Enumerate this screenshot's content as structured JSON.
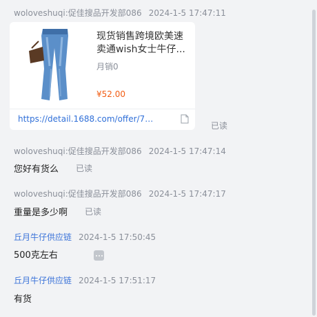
{
  "messages": [
    {
      "sender": "woloveshuqi:促佳搜品开发部086",
      "time": "2024-1-5 17:47:11",
      "card": {
        "title": "现货销售跨境欧美速卖通wish女士牛仔...",
        "sales": "月销0",
        "price": "¥52.00",
        "link": "https://detail.1688.com/offer/75..."
      },
      "status": "已读"
    },
    {
      "sender": "woloveshuqi:促佳搜品开发部086",
      "time": "2024-1-5 17:47:14",
      "text": "您好有货么",
      "status": "已读"
    },
    {
      "sender": "woloveshuqi:促佳搜品开发部086",
      "time": "2024-1-5 17:47:17",
      "text": "重量是多少啊",
      "status": "已读"
    },
    {
      "sender": "丘月牛仔供应链",
      "time": "2024-1-5 17:50:45",
      "text": "500克左右"
    },
    {
      "sender": "丘月牛仔供应链",
      "time": "2024-1-5 17:51:17",
      "text": "有货"
    }
  ],
  "icons": {
    "link": "document-icon",
    "more": "more-options-icon"
  },
  "colors": {
    "background": "#f2f3f5",
    "link": "#2f6fd8",
    "price": "#f25c12",
    "seller_name": "#3b73d9"
  }
}
